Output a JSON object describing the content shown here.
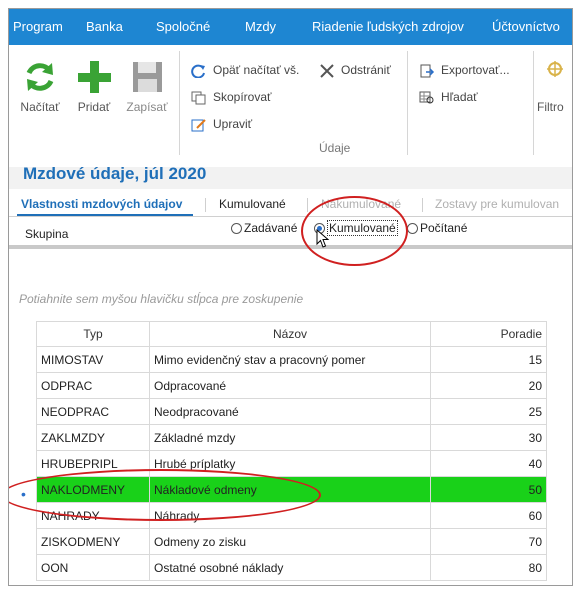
{
  "menu": [
    "Program",
    "Banka",
    "Spoločné",
    "Mzdy",
    "Riadenie ľudských zdrojov",
    "Účtovníctvo"
  ],
  "ribbon": {
    "big_buttons": [
      {
        "label": "Načítať",
        "icon": "refresh-icon"
      },
      {
        "label": "Pridať",
        "icon": "plus-icon"
      },
      {
        "label": "Zapísať",
        "icon": "save-icon"
      }
    ],
    "udaje_buttons": [
      {
        "label": "Opäť načítať vš.",
        "icon": "reload-all-icon"
      },
      {
        "label": "Skopírovať",
        "icon": "copy-icon"
      },
      {
        "label": "Upraviť",
        "icon": "edit-icon"
      },
      {
        "label": "Odstrániť",
        "icon": "delete-icon"
      }
    ],
    "export_buttons": [
      {
        "label": "Exportovať...",
        "icon": "export-icon"
      },
      {
        "label": "Hľadať",
        "icon": "search-grid-icon"
      }
    ],
    "filter_label": "Filtro",
    "group_label": "Údaje"
  },
  "page_title": "Mzdové údaje, júl 2020",
  "tabs": [
    {
      "label": "Vlastnosti mzdových údajov",
      "state": "active"
    },
    {
      "label": "Kumulované",
      "state": "normal"
    },
    {
      "label": "Nakumulované",
      "state": "disabled"
    },
    {
      "label": "Zostavy pre kumulovan",
      "state": "disabled"
    }
  ],
  "group": {
    "label": "Skupina",
    "options": [
      "Zadávané",
      "Kumulované",
      "Počítané"
    ],
    "selected": "Kumulované"
  },
  "grouping_hint": "Potiahnite sem myšou hlavičku stĺpca pre zoskupenie",
  "table": {
    "columns": [
      "Typ",
      "Názov",
      "Poradie"
    ],
    "rows": [
      {
        "typ": "MIMOSTAV",
        "nazov": "Mimo evidenčný stav a pracovný pomer",
        "poradie": "15"
      },
      {
        "typ": "ODPRAC",
        "nazov": "Odpracované",
        "poradie": "20"
      },
      {
        "typ": "NEODPRAC",
        "nazov": "Neodpracované",
        "poradie": "25"
      },
      {
        "typ": "ZAKLMZDY",
        "nazov": "Základné mzdy",
        "poradie": "30"
      },
      {
        "typ": "HRUBEPRIPL",
        "nazov": "Hrubé príplatky",
        "poradie": "40"
      },
      {
        "typ": "NAKLODMENY",
        "nazov": "Nákladové odmeny",
        "poradie": "50",
        "selected": true
      },
      {
        "typ": "NAHRADY",
        "nazov": "Náhrady",
        "poradie": "60"
      },
      {
        "typ": "ZISKODMENY",
        "nazov": "Odmeny zo zisku",
        "poradie": "70"
      },
      {
        "typ": "OON",
        "nazov": "Ostatné osobné náklady",
        "poradie": "80"
      }
    ]
  },
  "colors": {
    "menu_bg": "#1e86d2",
    "title": "#1f6fb8",
    "selected_row": "#19d119",
    "annotation": "#d02020"
  }
}
